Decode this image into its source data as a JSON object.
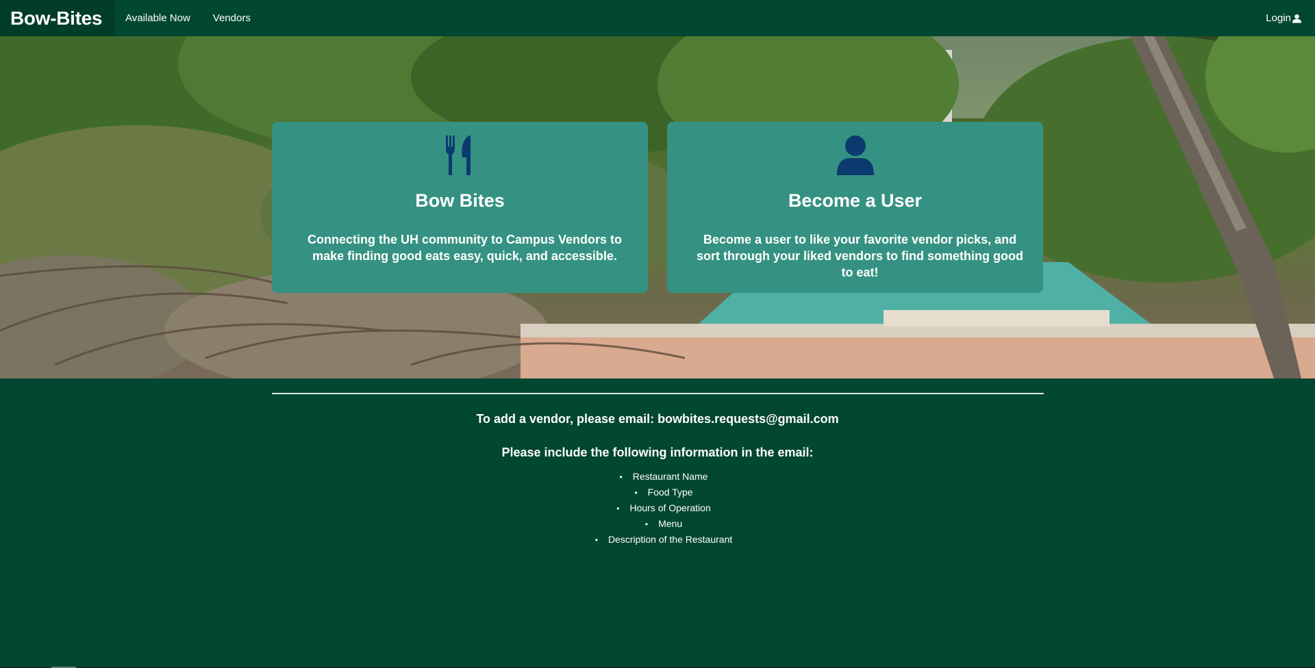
{
  "navbar": {
    "brand": "Bow-Bites",
    "links": [
      "Available Now",
      "Vendors"
    ],
    "login_label": "Login",
    "login_icon": "user-icon"
  },
  "hero": {
    "background": "campus-trees-photo",
    "cards": [
      {
        "icon": "utensils-icon",
        "title": "Bow Bites",
        "description": "Connecting the UH community to Campus Vendors to make finding good eats easy, quick, and accessible."
      },
      {
        "icon": "user-icon",
        "title": "Become a User",
        "description": "Become a user to like your favorite vendor picks, and sort through your liked vendors to find something good to eat!"
      }
    ]
  },
  "info": {
    "email_line": "To add a vendor, please email: bowbites.requests@gmail.com",
    "include_line": "Please include the following information in the email:",
    "items": [
      "Restaurant Name",
      "Food Type",
      "Hours of Operation",
      "Menu",
      "Description of the Restaurant"
    ]
  },
  "colors": {
    "nav_background": "#024731",
    "brand_background": "#013d2a",
    "card_background": "#359282",
    "icon_color": "#0b3b6e",
    "page_background": "#024731"
  }
}
